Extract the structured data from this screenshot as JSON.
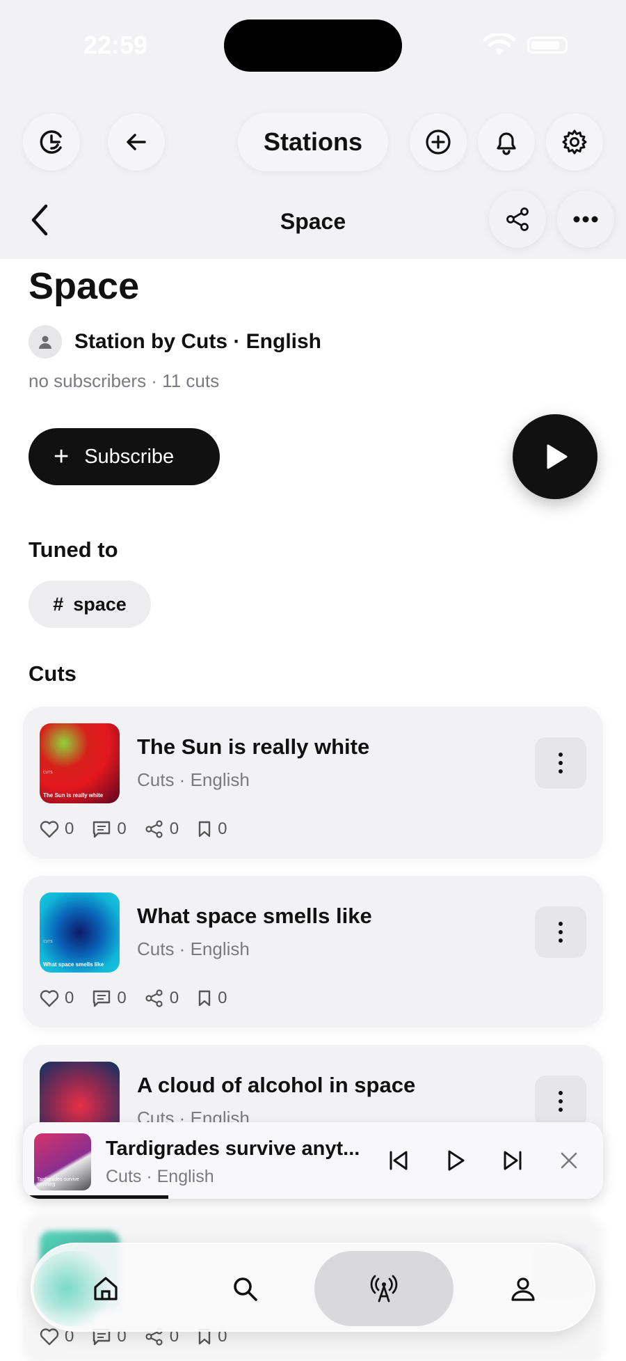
{
  "status": {
    "time": "22:59"
  },
  "topbar": {
    "title": "Stations"
  },
  "nav": {
    "title": "Space"
  },
  "station": {
    "title": "Space",
    "byline": "Station by Cuts · English",
    "meta": "no subscribers · 11 cuts",
    "subscribe_label": "Subscribe"
  },
  "tuned": {
    "heading": "Tuned to",
    "tags": [
      "space"
    ]
  },
  "cuts": {
    "heading": "Cuts",
    "items": [
      {
        "title": "The Sun is really white",
        "subtitle": "Cuts · English",
        "thumb_caption": "The Sun is really white",
        "likes": "0",
        "comments": "0",
        "shares": "0",
        "saves": "0"
      },
      {
        "title": "What space smells like",
        "subtitle": "Cuts · English",
        "thumb_caption": "What space smells like",
        "likes": "0",
        "comments": "0",
        "shares": "0",
        "saves": "0"
      },
      {
        "title": "A cloud of alcohol in space",
        "subtitle": "Cuts · English"
      },
      {
        "likes": "0",
        "comments": "0",
        "shares": "0",
        "saves": "0"
      }
    ]
  },
  "player": {
    "title": "Tardigrades survive anyt...",
    "subtitle": "Cuts · English",
    "thumb_caption": "Tardigrades survive anything",
    "progress": 0.25
  },
  "tabs": [
    "home-icon",
    "search-icon",
    "radio-tower-icon",
    "profile-icon"
  ]
}
